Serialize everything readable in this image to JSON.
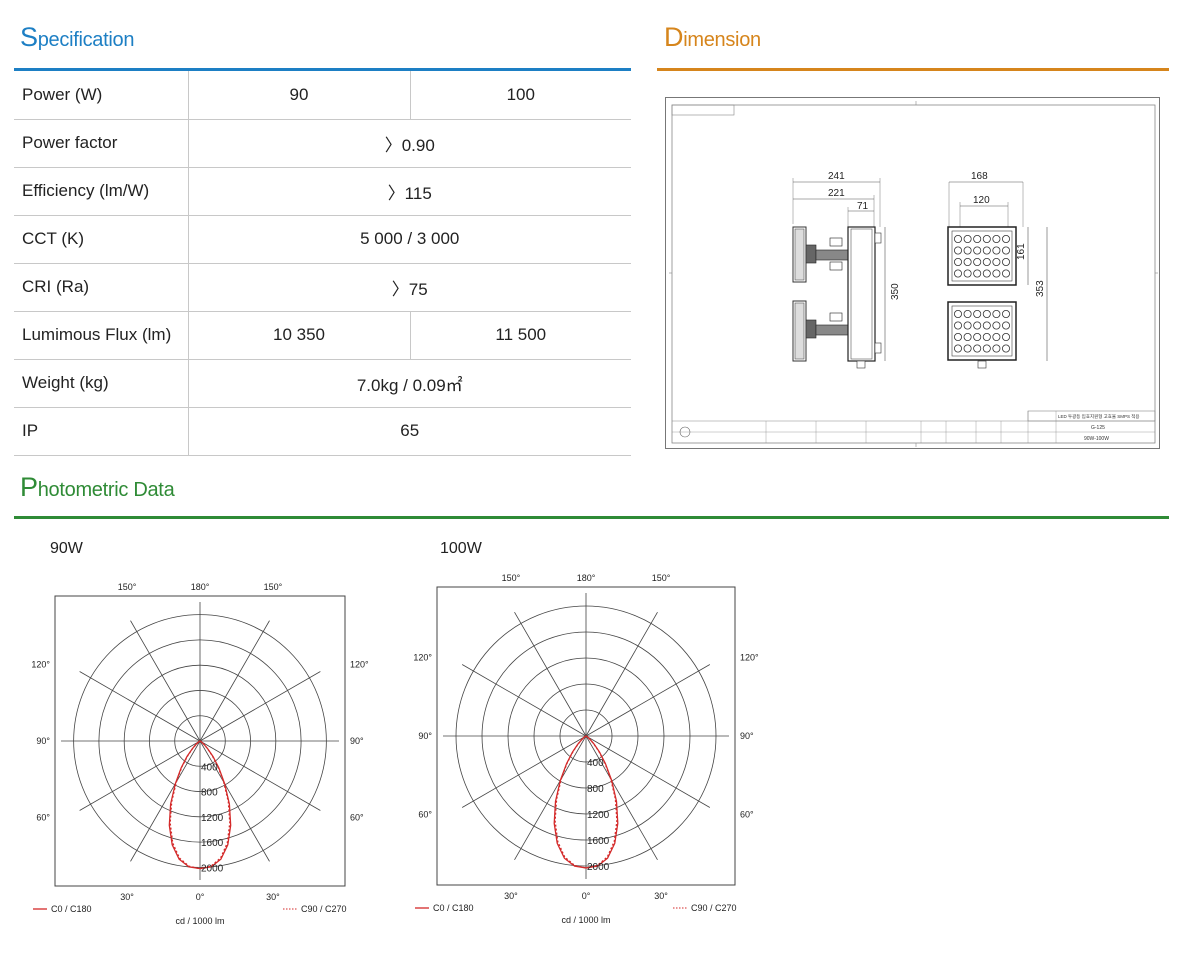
{
  "specification": {
    "title_cap": "S",
    "title_rest": "pecification",
    "rows": [
      {
        "label": "Power (W)",
        "values": [
          "90",
          "100"
        ]
      },
      {
        "label": "Power factor",
        "values": [
          "〉0.90"
        ]
      },
      {
        "label": "Efficiency (lm/W)",
        "values": [
          "〉115"
        ]
      },
      {
        "label": "CCT (K)",
        "values": [
          "5 000 / 3 000"
        ]
      },
      {
        "label": "CRI (Ra)",
        "values": [
          "〉75"
        ]
      },
      {
        "label": "Lumimous Flux (lm)",
        "values": [
          "10 350",
          "11 500"
        ]
      },
      {
        "label": "Weight (kg)",
        "values": [
          "7.0kg / 0.09㎡"
        ]
      },
      {
        "label": "IP",
        "values": [
          "65"
        ]
      }
    ]
  },
  "dimension": {
    "title_cap": "D",
    "title_rest": "imension",
    "side_view": {
      "overall_width": "241",
      "inner_width": "221",
      "depth": "71",
      "height": "350"
    },
    "front_view": {
      "overall_width": "168",
      "inner_width": "120",
      "module_height": "161",
      "height": "353"
    },
    "title_block": {
      "drawing_name": "LED 투광등 입효지원형 고효율 SMPS 적용",
      "code": "G-125",
      "model": "90W-100W"
    }
  },
  "photometric": {
    "title_cap": "P",
    "title_rest": "hotometric Data",
    "charts": [
      {
        "caption": "90W",
        "angle_labels": {
          "top_left": "150°",
          "top": "180°",
          "top_right": "150°",
          "left_upper": "120°",
          "right_upper": "120°",
          "left_mid": "90°",
          "right_mid": "90°",
          "left_lower": "60°",
          "right_lower": "60°",
          "bottom_left": "30°",
          "bottom": "0°",
          "bottom_right": "30°"
        },
        "legend_c0": "C0 / C180",
        "legend_c90": "C90 / C270",
        "unit": "cd / 1000 lm"
      },
      {
        "caption": "100W",
        "angle_labels": {
          "top_left": "150°",
          "top": "180°",
          "top_right": "150°",
          "left_upper": "120°",
          "right_upper": "120°",
          "left_mid": "90°",
          "right_mid": "90°",
          "left_lower": "60°",
          "right_lower": "60°",
          "bottom_left": "30°",
          "bottom": "0°",
          "bottom_right": "30°"
        },
        "legend_c0": "C0 / C180",
        "legend_c90": "C90 / C270",
        "unit": "cd / 1000 lm"
      }
    ]
  },
  "chart_data": [
    {
      "type": "polar",
      "title": "90W",
      "radial_labels": [
        "400",
        "800",
        "1200",
        "1600",
        "2000"
      ],
      "rlim": [
        0,
        2200
      ],
      "unit": "cd / 1000 lm",
      "series": [
        {
          "name": "C0 / C180",
          "color": "#d42a2a",
          "style": "solid",
          "angles_deg": [
            0,
            5,
            10,
            15,
            20,
            25,
            30,
            35,
            40,
            45,
            50,
            60,
            70,
            80,
            90
          ],
          "values": [
            2020,
            2000,
            1900,
            1700,
            1420,
            1100,
            780,
            520,
            320,
            170,
            80,
            20,
            5,
            0,
            0
          ]
        },
        {
          "name": "C90 / C270",
          "color": "#d42a2a",
          "style": "dotted",
          "angles_deg": [
            0,
            5,
            10,
            15,
            20,
            25,
            30,
            35,
            40,
            45,
            50,
            60,
            70,
            80,
            90
          ],
          "values": [
            2020,
            1990,
            1880,
            1670,
            1380,
            1060,
            750,
            500,
            300,
            160,
            75,
            18,
            4,
            0,
            0
          ]
        }
      ]
    },
    {
      "type": "polar",
      "title": "100W",
      "radial_labels": [
        "400",
        "800",
        "1200",
        "1600",
        "2000"
      ],
      "rlim": [
        0,
        2200
      ],
      "unit": "cd / 1000 lm",
      "series": [
        {
          "name": "C0 / C180",
          "color": "#d42a2a",
          "style": "solid",
          "angles_deg": [
            0,
            5,
            10,
            15,
            20,
            25,
            30,
            35,
            40,
            45,
            50,
            60,
            70,
            80,
            90
          ],
          "values": [
            2030,
            2010,
            1910,
            1710,
            1430,
            1110,
            790,
            525,
            325,
            175,
            82,
            20,
            5,
            0,
            0
          ]
        },
        {
          "name": "C90 / C270",
          "color": "#d42a2a",
          "style": "dotted",
          "angles_deg": [
            0,
            5,
            10,
            15,
            20,
            25,
            30,
            35,
            40,
            45,
            50,
            60,
            70,
            80,
            90
          ],
          "values": [
            2030,
            2000,
            1890,
            1680,
            1390,
            1070,
            760,
            505,
            305,
            165,
            78,
            18,
            4,
            0,
            0
          ]
        }
      ]
    }
  ]
}
